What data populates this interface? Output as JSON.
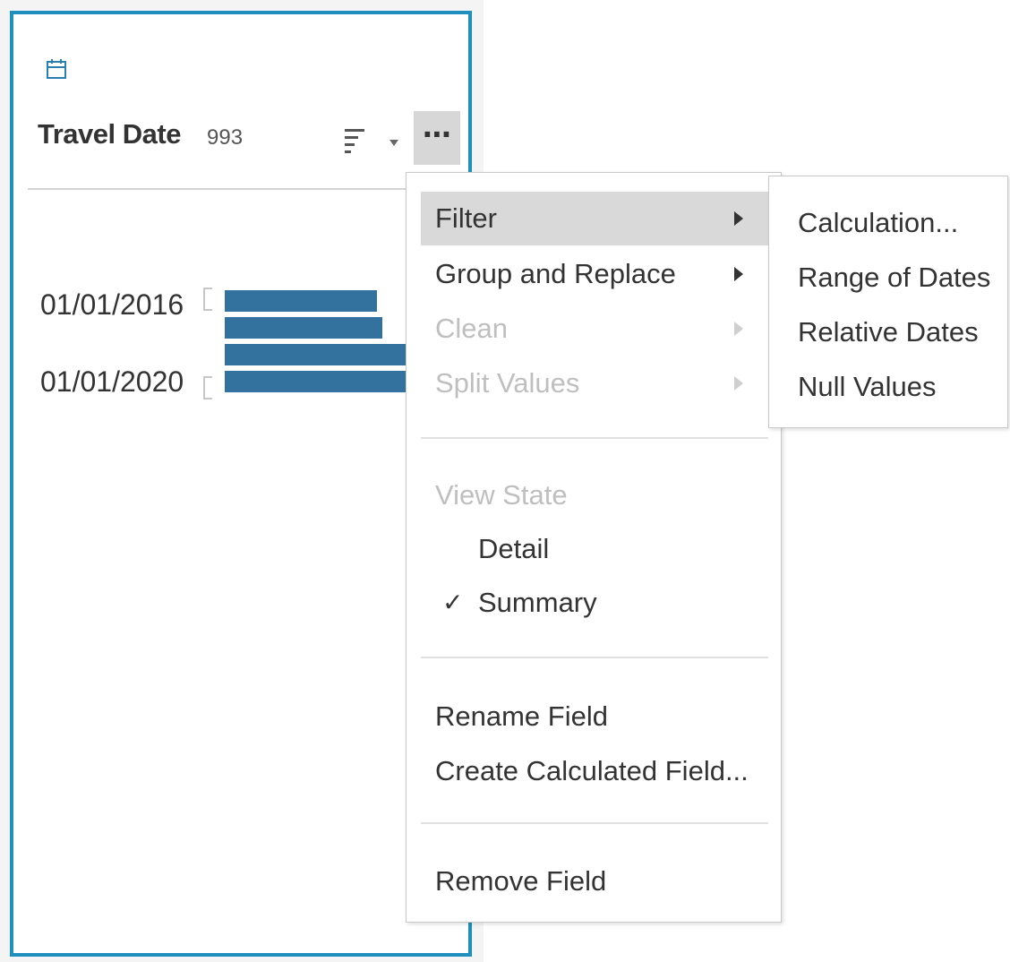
{
  "field_card": {
    "title": "Travel Date",
    "count": "993",
    "type_icon": "calendar-icon",
    "sort_icon": "sort-icon",
    "more_label": "⋯",
    "chart": {
      "axis_labels": [
        "01/01/2016",
        "01/01/2020"
      ],
      "bar_color": "#33729e"
    }
  },
  "chart_data": {
    "type": "bar",
    "orientation": "horizontal",
    "tick_labels": [
      "01/01/2016",
      "01/01/2020"
    ]
  },
  "context_menu": {
    "items": [
      {
        "label": "Filter",
        "submenu": true,
        "enabled": true,
        "active": true
      },
      {
        "label": "Group and Replace",
        "submenu": true,
        "enabled": true,
        "active": false
      },
      {
        "label": "Clean",
        "submenu": true,
        "enabled": false,
        "active": false
      },
      {
        "label": "Split Values",
        "submenu": true,
        "enabled": false,
        "active": false
      }
    ],
    "view_state": {
      "label": "View State",
      "options": [
        {
          "label": "Detail",
          "checked": false
        },
        {
          "label": "Summary",
          "checked": true
        }
      ],
      "check_glyph": "✓"
    },
    "actions": [
      "Rename Field",
      "Create Calculated Field...",
      "Remove Field"
    ]
  },
  "filter_submenu": {
    "items": [
      "Calculation...",
      "Range of Dates",
      "Relative Dates",
      "Null Values"
    ]
  },
  "colors": {
    "card_border": "#1f8fbf",
    "bar": "#33729e",
    "menu_active": "#d9d9d9",
    "disabled_text": "#bfbfbf"
  }
}
